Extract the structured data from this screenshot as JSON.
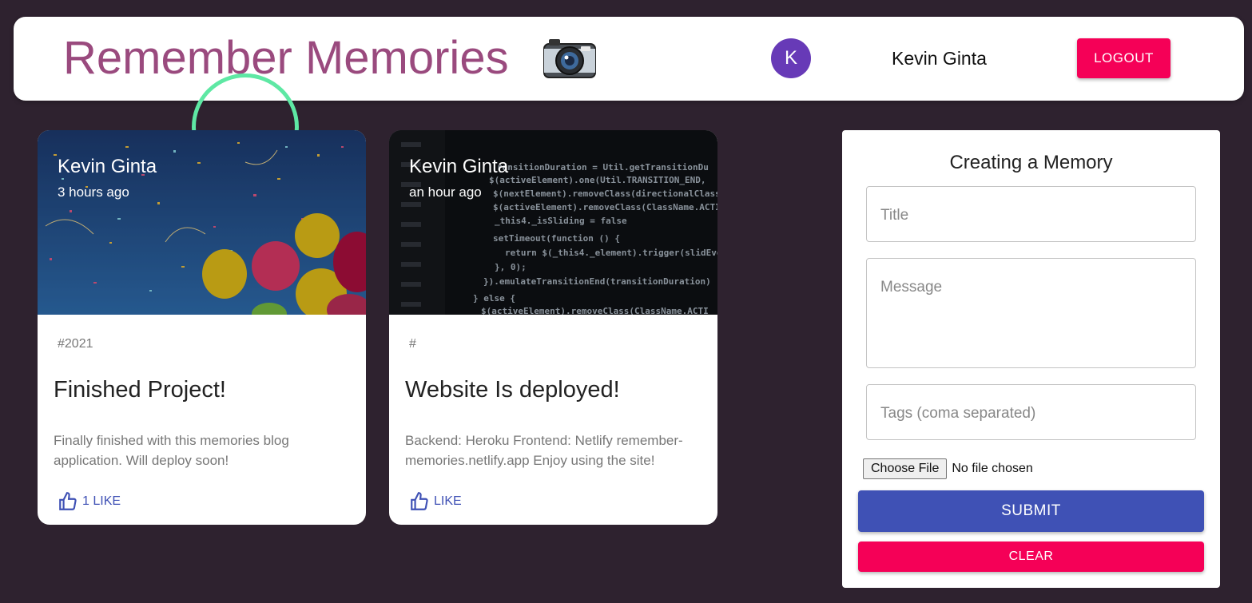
{
  "header": {
    "title": "Remember Memories",
    "avatar_initial": "K",
    "username": "Kevin Ginta",
    "logout_label": "LOGOUT"
  },
  "posts": [
    {
      "creator": "Kevin Ginta",
      "time": "3 hours ago",
      "tags": "#2021",
      "title": "Finished Project!",
      "message": "Finally finished with this memories blog application. Will deploy soon!",
      "like_label": "1 LIKE",
      "image": "balloons-confetti"
    },
    {
      "creator": "Kevin Ginta",
      "time": "an hour ago",
      "tags": "#",
      "title": "Website Is deployed!",
      "message": "Backend: Heroku Frontend: Netlify remember-memories.netlify.app Enjoy using the site!",
      "like_label": "LIKE",
      "image": "code-screen"
    }
  ],
  "form": {
    "heading": "Creating a Memory",
    "title_placeholder": "Title",
    "message_placeholder": "Message",
    "tags_placeholder": "Tags (coma separated)",
    "choose_file_label": "Choose File",
    "file_status": "No file chosen",
    "submit_label": "SUBMIT",
    "clear_label": "CLEAR"
  },
  "colors": {
    "background": "#2e222f",
    "brand": "#9a4a7e",
    "primary": "#3f51b5",
    "secondary": "#f50057",
    "avatar": "#673ab7",
    "spinner": "#5ee8a4"
  },
  "icons": {
    "logo": "camera-icon",
    "like": "thumb-up-icon"
  }
}
